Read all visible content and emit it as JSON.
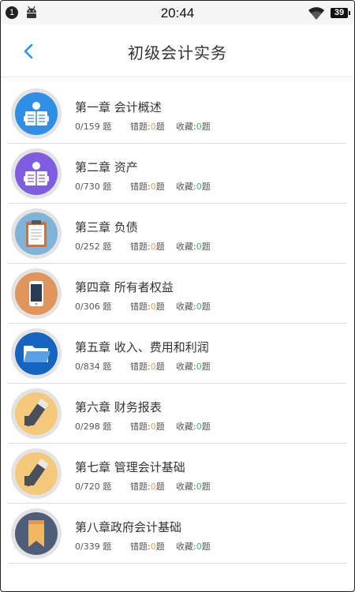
{
  "status_bar": {
    "notification_count": "1",
    "time": "20:44",
    "battery": "39"
  },
  "header": {
    "title": "初级会计实务",
    "back_icon": "chevron-left-icon"
  },
  "labels": {
    "wrong": "错题:",
    "favorite": "收藏:",
    "unit": "题"
  },
  "colors": {
    "accent": "#2196f3",
    "count_orange": "#f0a050",
    "count_green": "#3bb873"
  },
  "chapters": [
    {
      "title": "第一章 会计概述",
      "progress": "0/159",
      "wrong": "0",
      "favorite": "0",
      "icon": "reading-person-icon",
      "icon_color": "#2f8fe6"
    },
    {
      "title": "第二章 资产",
      "progress": "0/730",
      "wrong": "0",
      "favorite": "0",
      "icon": "reading-person-icon",
      "icon_color": "#7f5ce0"
    },
    {
      "title": "第三章 负债",
      "progress": "0/252",
      "wrong": "0",
      "favorite": "0",
      "icon": "clipboard-icon",
      "icon_color": "#7fb4d8"
    },
    {
      "title": "第四章 所有者权益",
      "progress": "0/306",
      "wrong": "0",
      "favorite": "0",
      "icon": "smartphone-icon",
      "icon_color": "#e0965a"
    },
    {
      "title": "第五章 收入、费用和利润",
      "progress": "0/834",
      "wrong": "0",
      "favorite": "0",
      "icon": "folder-icon",
      "icon_color": "#1565c0"
    },
    {
      "title": "第六章 财务报表",
      "progress": "0/298",
      "wrong": "0",
      "favorite": "0",
      "icon": "eraser-pencil-icon",
      "icon_color": "#f5c97a"
    },
    {
      "title": "第七章 管理会计基础",
      "progress": "0/720",
      "wrong": "0",
      "favorite": "0",
      "icon": "eraser-pencil-icon",
      "icon_color": "#f5c97a"
    },
    {
      "title": "第八章政府会计基础",
      "progress": "0/339",
      "wrong": "0",
      "favorite": "0",
      "icon": "bookmark-icon",
      "icon_color": "#4d5e78"
    }
  ]
}
